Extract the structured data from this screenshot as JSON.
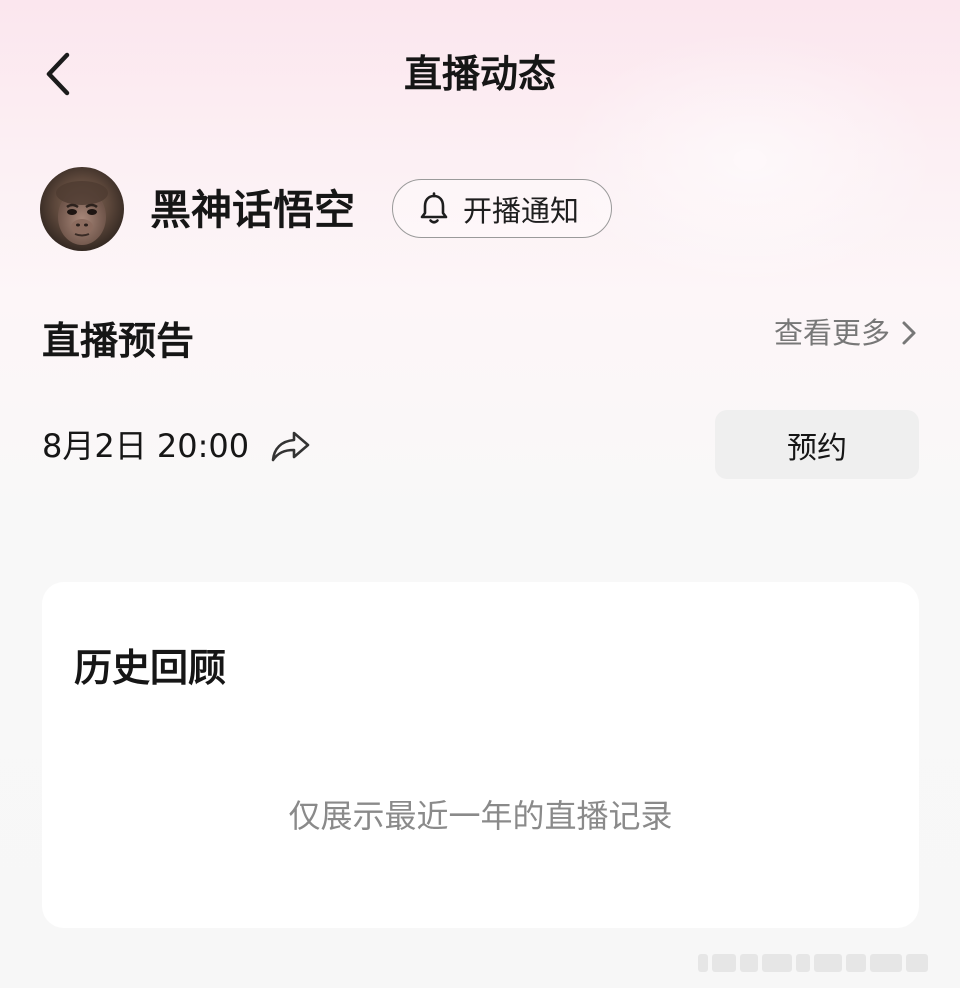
{
  "header": {
    "title": "直播动态",
    "back_icon": "chevron-left-icon"
  },
  "streamer": {
    "name": "黑神话悟空",
    "avatar": "monkey-king-avatar",
    "notify_button_label": "开播通知",
    "notify_icon": "bell-icon"
  },
  "preview": {
    "section_title": "直播预告",
    "see_more_label": "查看更多",
    "see_more_icon": "chevron-right-icon",
    "schedule_time": "8月2日 20:00",
    "share_icon": "share-arrow-icon",
    "reserve_button_label": "预约"
  },
  "history": {
    "title": "历史回顾",
    "empty_text": "仅展示最近一年的直播记录"
  },
  "colors": {
    "background_top": "#fbe6ee",
    "background_bottom": "#f7f7f7",
    "text_primary": "#161616",
    "text_secondary": "#777777",
    "button_gray": "#efefef",
    "card": "#ffffff"
  }
}
